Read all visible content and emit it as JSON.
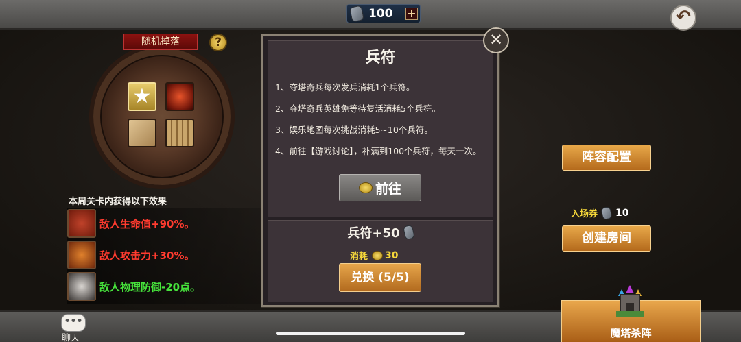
{
  "topbar": {
    "currency_value": "100",
    "plus_label": "+",
    "back_label": "↶"
  },
  "drop": {
    "title": "随机掉落",
    "help_label": "?",
    "star_glyph": "★"
  },
  "effects": {
    "title": "本周关卡内获得以下效果",
    "items": [
      {
        "label": "敌人生命值+90%。",
        "color": "#ff3b2f"
      },
      {
        "label": "敌人攻击力+30%。",
        "color": "#ff3b2f"
      },
      {
        "label": "敌人物理防御-20点。",
        "color": "#46e23b"
      }
    ]
  },
  "dialog": {
    "title": "兵符",
    "close_label": "✕",
    "rules": [
      "1、夺塔奇兵每次发兵消耗1个兵符。",
      "2、夺塔奇兵英雄免等待复活消耗5个兵符。",
      "3、娱乐地图每次挑战消耗5~10个兵符。",
      "4、前往【游戏讨论】，补满到100个兵符，每天一次。"
    ],
    "goto_label": "前往",
    "reward_label": "兵符+50",
    "cost_label": "消耗",
    "cost_value": "30",
    "exchange_label": "兑换 (5/5)"
  },
  "right": {
    "formation_label": "阵容配置",
    "ticket_label": "入场券",
    "ticket_value": "10",
    "create_room_label": "创建房间",
    "tower_label": "魔塔杀阵"
  },
  "chat": {
    "icon_glyph": "•••",
    "label": "聊天"
  },
  "colors": {
    "accent_orange": "#e8a849",
    "cost_yellow": "#f5d73a",
    "buff_red": "#ff3b2f",
    "debuff_green": "#46e23b"
  }
}
